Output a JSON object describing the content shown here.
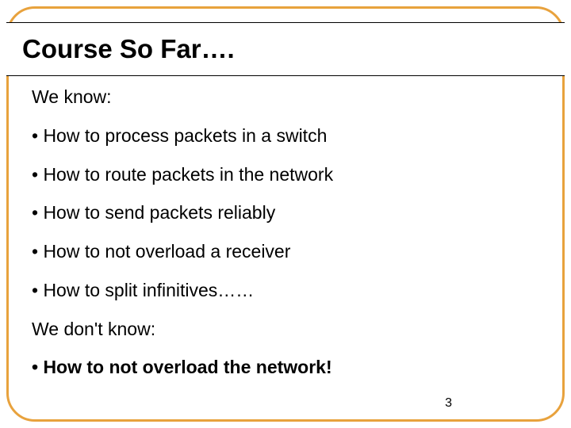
{
  "slide": {
    "title": "Course So Far….",
    "lines": {
      "l0": "We know:",
      "l1": "• How to process packets in a switch",
      "l2": "• How to route packets in the network",
      "l3": "• How to send packets reliably",
      "l4": "• How to not overload a receiver",
      "l5": "• How to split infinitives……",
      "l6": "We don't know:",
      "l7": "• How to not overload the network!"
    },
    "page_number": "3"
  }
}
